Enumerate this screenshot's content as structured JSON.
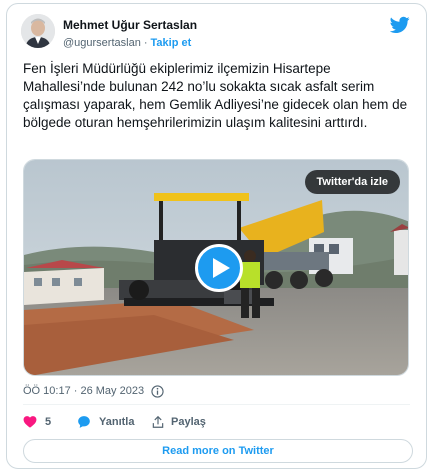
{
  "author": {
    "display_name": "Mehmet Uğur Sertaslan",
    "handle": "@ugursertaslan",
    "separator": "·",
    "follow_label": "Takip et"
  },
  "tweet": {
    "text": "Fen İşleri Müdürlüğü ekiplerimiz ilçemizin Hisartepe Mahallesi’nde bulunan 242 no’lu sokakta sıcak asfalt serim çalışması yaparak, hem Gemlik Adliyesi’ne gidecek olan hem de bölgede oturan hemşehrilerimizin ulaşım kalitesini arttırdı.",
    "timestamp": "ÖÖ 10:17 · 26 May 2023"
  },
  "media": {
    "watch_label": "Twitter'da izle"
  },
  "actions": {
    "like_count": "5",
    "reply_label": "Yanıtla",
    "share_label": "Paylaş"
  },
  "footer": {
    "read_more_label": "Read more on Twitter"
  },
  "colors": {
    "accent": "#1d9bf0",
    "like": "#f91880",
    "text_secondary": "#536471"
  }
}
